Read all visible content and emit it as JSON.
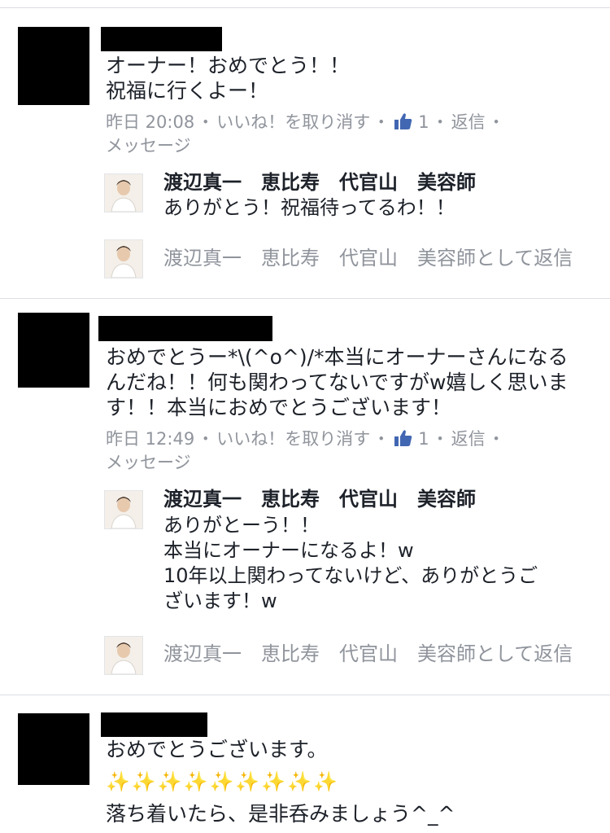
{
  "comments": [
    {
      "text": "オーナー！おめでとう！！\n祝福に行くよー！",
      "time": "昨日 20:08",
      "unlike_label": "いいね！を取り消す",
      "like_count": "1",
      "reply_label": "返信",
      "message_label": "メッセージ",
      "reply": {
        "name": "渡辺真一　恵比寿　代官山　美容師",
        "text": "ありがとう！祝福待ってるわ！！"
      },
      "reply_input_placeholder": "渡辺真一　恵比寿　代官山　美容師として返信"
    },
    {
      "text": "おめでとうー*\\(^o^)/*本当にオーナーさんになる\nんだね！！何も関わってないですがw嬉しく思いま\nす！！本当におめでとうございます！",
      "time": "昨日 12:49",
      "unlike_label": "いいね！を取り消す",
      "like_count": "1",
      "reply_label": "返信",
      "message_label": "メッセージ",
      "reply": {
        "name": "渡辺真一　恵比寿　代官山　美容師",
        "text": "ありがとーう！！\n本当にオーナーになるよ！w\n10年以上関わってないけど、ありがとうご\nざいます！w"
      },
      "reply_input_placeholder": "渡辺真一　恵比寿　代官山　美容師として返信"
    },
    {
      "text": "おめでとうございます。",
      "emoji": "✨✨✨✨✨✨✨✨✨",
      "text2": "落ち着いたら、是非呑みましょう^_^"
    }
  ],
  "colors": {
    "text": "#1d2129",
    "meta": "#90949c",
    "like_blue": "#4267b2",
    "divider": "#dcdee3"
  },
  "icons": {
    "like": "thumbs-up-icon",
    "avatar": "profile-photo"
  }
}
